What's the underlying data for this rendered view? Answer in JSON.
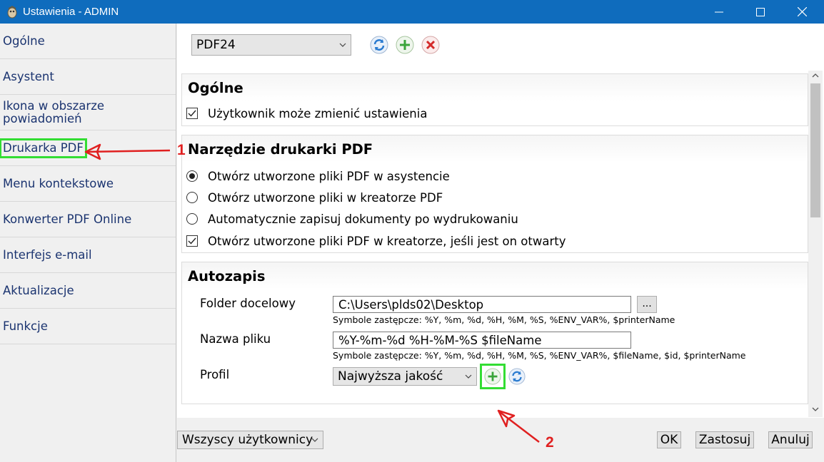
{
  "window": {
    "title": "Ustawienia - ADMIN",
    "icons": {
      "app": "app-icon",
      "minimize": "minimize-icon",
      "maximize": "maximize-icon",
      "close": "close-icon"
    }
  },
  "sidebar": {
    "items": [
      {
        "label": "Ogólne"
      },
      {
        "label": "Asystent"
      },
      {
        "label": "Ikona w obszarze powiadomień"
      },
      {
        "label": "Drukarka PDF",
        "active": true
      },
      {
        "label": "Menu kontekstowe"
      },
      {
        "label": "Konwerter PDF Online"
      },
      {
        "label": "Interfejs e-mail"
      },
      {
        "label": "Aktualizacje"
      },
      {
        "label": "Funkcje"
      }
    ]
  },
  "printer_select": {
    "value": "PDF24"
  },
  "toolbar_icons": {
    "refresh": "refresh-icon",
    "add": "add-icon",
    "delete": "delete-icon"
  },
  "sections": {
    "general": {
      "title": "Ogólne",
      "user_can_change": {
        "label": "Użytkownik może zmienić ustawienia",
        "checked": true
      }
    },
    "tool": {
      "title": "Narzędzie drukarki PDF",
      "options": [
        {
          "label": "Otwórz utworzone pliki PDF w asystencie",
          "selected": true
        },
        {
          "label": "Otwórz utworzone pliki w kreatorze PDF",
          "selected": false
        },
        {
          "label": "Automatycznie zapisuj dokumenty po wydrukowaniu",
          "selected": false
        }
      ],
      "open_in_creator": {
        "label": "Otwórz utworzone pliki PDF w kreatorze, jeśli jest on otwarty",
        "checked": true
      }
    },
    "autosave": {
      "title": "Autozapis",
      "folder": {
        "label": "Folder docelowy",
        "value": "C:\\Users\\plds02\\Desktop",
        "hint": "Symbole zastępcze: %Y, %m, %d, %H, %M, %S, %ENV_VAR%, $printerName",
        "browse_label": "..."
      },
      "filename": {
        "label": "Nazwa pliku",
        "value": "%Y-%m-%d %H-%M-%S $fileName",
        "hint": "Symbole zastępcze: %Y, %m, %d, %H, %M, %S, %ENV_VAR%, $fileName, $id, $printerName"
      },
      "profile": {
        "label": "Profil",
        "value": "Najwyższa jakość"
      }
    }
  },
  "footer": {
    "scope_select": "Wszyscy użytkownicy",
    "ok": "OK",
    "apply": "Zastosuj",
    "cancel": "Anuluj"
  },
  "annotations": {
    "one": "1",
    "two": "2",
    "color": "#e02020",
    "highlight_color": "#33dd33"
  },
  "colors": {
    "titlebar": "#0f6cbd",
    "sidebar_text": "#1b3470"
  }
}
